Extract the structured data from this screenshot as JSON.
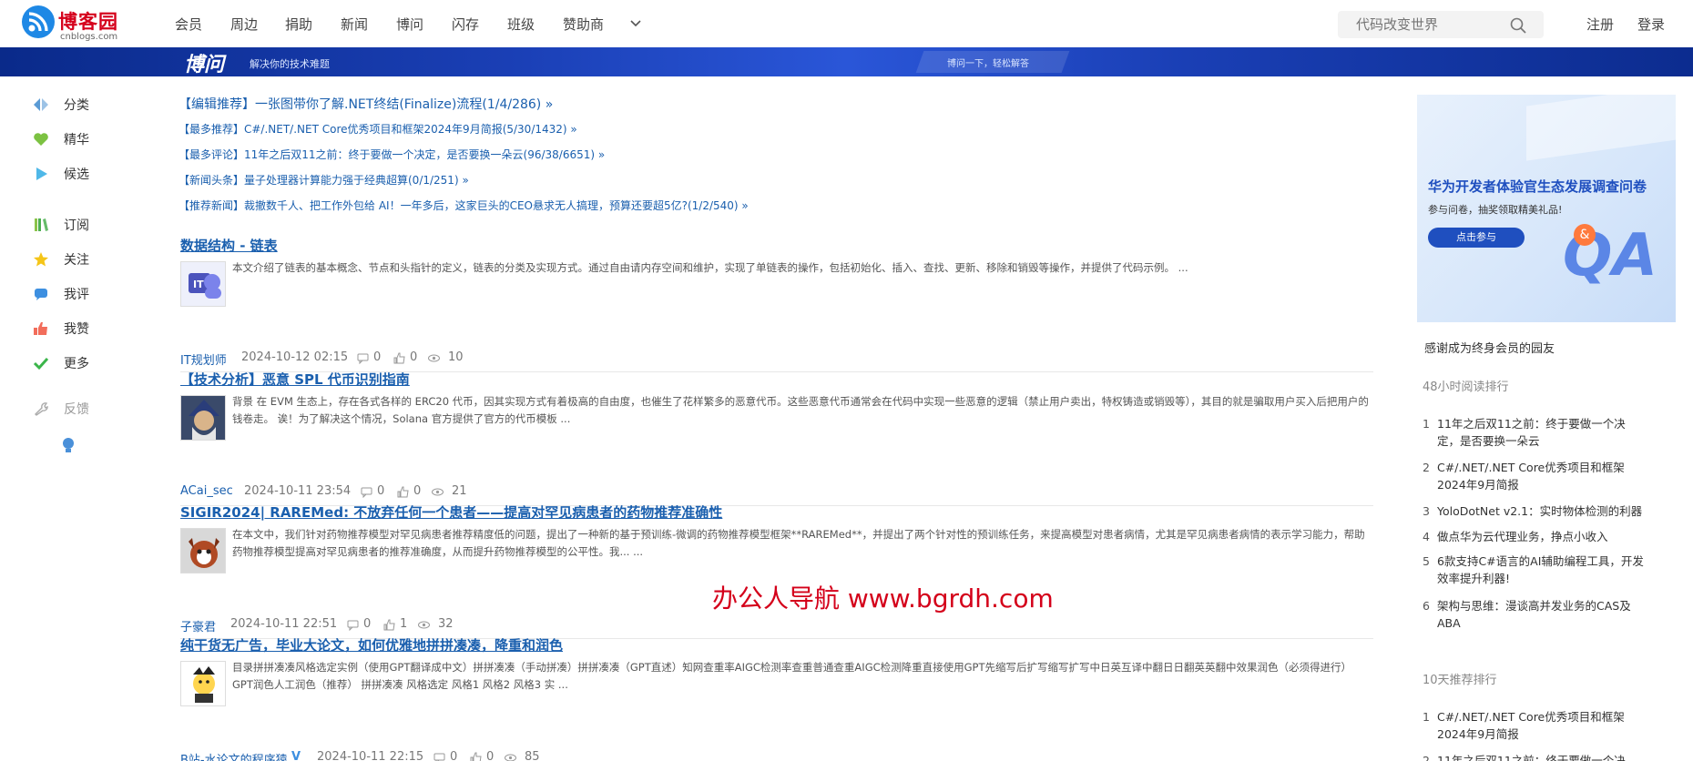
{
  "header": {
    "logo_name": "博客园",
    "logo_sub": "cnblogs.com",
    "nav": [
      "会员",
      "周边",
      "捐助",
      "新闻",
      "博问",
      "闪存",
      "班级",
      "赞助商"
    ],
    "search_placeholder": "代码改变世界",
    "register": "注册",
    "login": "登录"
  },
  "banner": {
    "title": "博问",
    "subtitle": "解决你的技术难题",
    "right_text": "博问一下，轻松解答"
  },
  "sidebar": {
    "items": [
      {
        "label": "分类",
        "icon": "category-icon"
      },
      {
        "label": "精华",
        "icon": "heart-icon"
      },
      {
        "label": "候选",
        "icon": "play-icon"
      },
      {
        "label": "订阅",
        "icon": "bookshelf-icon"
      },
      {
        "label": "关注",
        "icon": "star-icon"
      },
      {
        "label": "我评",
        "icon": "comment-icon"
      },
      {
        "label": "我赞",
        "icon": "thumbs-up-icon"
      },
      {
        "label": "更多",
        "icon": "check-icon"
      },
      {
        "label": "反馈",
        "icon": "wrench-icon"
      }
    ]
  },
  "headlines": [
    "【编辑推荐】一张图带你了解.NET终结(Finalize)流程(1/4/286) »",
    "【最多推荐】C#/.NET/.NET Core优秀项目和框架2024年9月简报(5/30/1432) »",
    "【最多评论】11年之后双11之前：终于要做一个决定，是否要换一朵云(96/38/6651) »",
    "【新闻头条】量子处理器计算能力强于经典超算(0/1/251) »",
    "【推荐新闻】裁撤数千人、把工作外包给 AI！一年多后，这家巨头的CEO悬求无人搞理，预算还要超5亿?(1/2/540) »"
  ],
  "posts": [
    {
      "title": "数据结构 - 链表",
      "summary": "本文介绍了链表的基本概念、节点和头指针的定义，链表的分类及实现方式。通过自由请内存空间和维护，实现了单链表的操作，包括初始化、插入、查找、更新、移除和销毁等操作，并提供了代码示例。 ...",
      "author": "IT规划师",
      "date": "2024-10-12 02:15",
      "comments": "0",
      "likes": "0",
      "views": "10"
    },
    {
      "title": "【技术分析】恶意 SPL 代币识别指南",
      "summary": "背景 在 EVM 生态上，存在各式各样的 ERC20 代币，因其实现方式有着极高的自由度，也催生了花样繁多的恶意代币。这些恶意代币通常会在代码中实现一些恶意的逻辑（禁止用户卖出，特权铸造或销毁等），其目的就是骗取用户买入后把用户的钱卷走。 诶！为了解决这个情况，Solana 官方提供了官方的代币模板 ...",
      "author": "ACai_sec",
      "date": "2024-10-11 23:54",
      "comments": "0",
      "likes": "0",
      "views": "21"
    },
    {
      "title": "SIGIR2024| RAREMed: 不放弃任何一个患者——提高对罕见病患者的药物推荐准确性",
      "summary": "在本文中，我们针对药物推荐模型对罕见病患者推荐精度低的问题，提出了一种新的基于预训练-微调的药物推荐模型框架**RAREMed**，并提出了两个针对性的预训练任务，来提高模型对患者病情，尤其是罕见病患者病情的表示学习能力，帮助药物推荐模型提高对罕见病患者的推荐准确度，从而提升药物推荐模型的公平性。我... ...",
      "author": "子豪君",
      "date": "2024-10-11 22:51",
      "comments": "0",
      "likes": "1",
      "views": "32"
    },
    {
      "title": "纯干货无广告，毕业大论文，如何优雅地拼拼凑凑，降重和润色",
      "summary": "目录拼拼凑凑风格选定实例（使用GPT翻译成中文）拼拼凑凑（手动拼凑）拼拼凑凑（GPT直述）知网查重率AIGC检测率查重普通查重AIGC检测降重直接使用GPT先缩写后扩写缩写扩写中日英互译中翻日日翻英英翻中效果润色（必须得进行）GPT润色人工润色（推荐） 拼拼凑凑 风格选定 风格1 风格2 风格3 实 ...",
      "author": "B站-水论文的程序猿",
      "author_badge": "V",
      "date": "2024-10-11 22:15",
      "comments": "0",
      "likes": "0",
      "views": "85"
    }
  ],
  "watermark": "办公人导航 www.bgrdh.com",
  "rightbar": {
    "ad": {
      "title": "华为开发者体验官生态发展调查问卷",
      "subtitle": "参与问卷，抽奖领取精美礼品!",
      "button": "点击参与",
      "qa": "QA",
      "amp": "&"
    },
    "member_text": "感谢成为终身会员的园友",
    "rank48_title": "48小时阅读排行",
    "rank48": [
      "11年之后双11之前：终于要做一个决定，是否要换一朵云",
      "C#/.NET/.NET Core优秀项目和框架2024年9月简报",
      "YoloDotNet v2.1：实时物体检测的利器",
      "做点华为云代理业务，挣点小收入",
      "6款支持C#语言的AI辅助编程工具，开发效率提升利器!",
      "架构与思维：漫谈高并发业务的CAS及ABA"
    ],
    "rank10_title": "10天推荐排行",
    "rank10": [
      "C#/.NET/.NET Core优秀项目和框架2024年9月简报",
      "11年之后双11之前：终于要做一个决"
    ],
    "rank_nums": [
      "1",
      "2",
      "3",
      "4",
      "5",
      "6"
    ]
  }
}
